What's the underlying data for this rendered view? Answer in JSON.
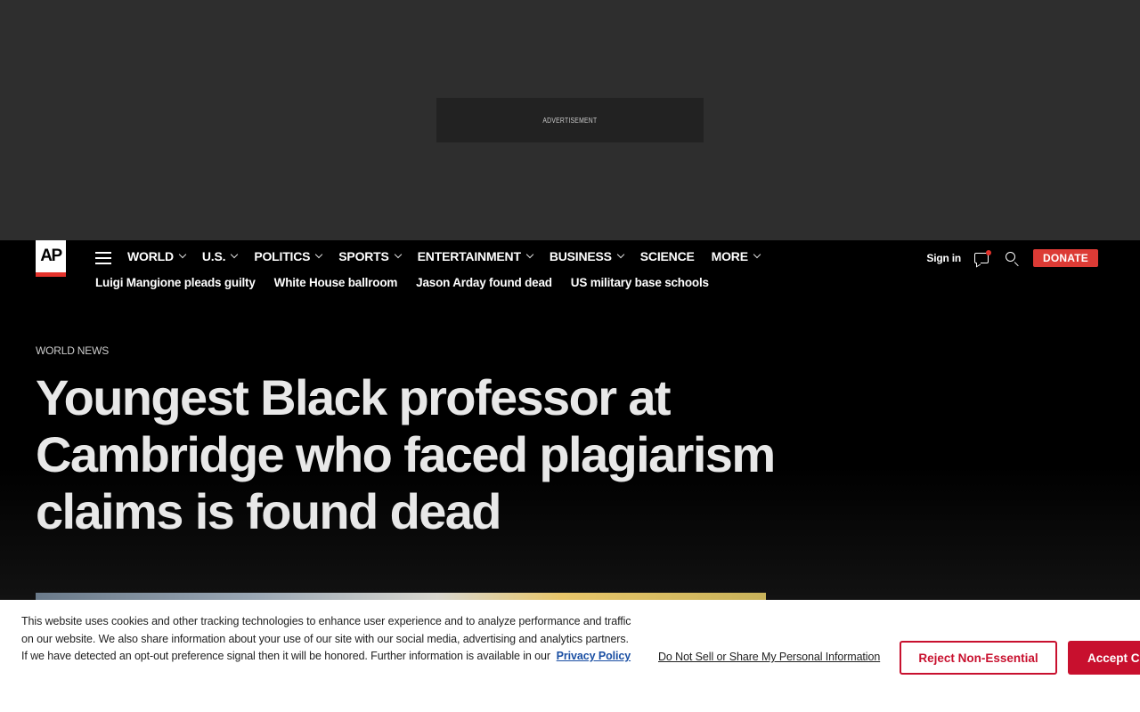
{
  "ad": {
    "label": "ADVERTISEMENT"
  },
  "header": {
    "logo": "AP",
    "nav": [
      {
        "label": "WORLD",
        "has_menu": true
      },
      {
        "label": "U.S.",
        "has_menu": true
      },
      {
        "label": "POLITICS",
        "has_menu": true
      },
      {
        "label": "SPORTS",
        "has_menu": true
      },
      {
        "label": "ENTERTAINMENT",
        "has_menu": true
      },
      {
        "label": "BUSINESS",
        "has_menu": true
      },
      {
        "label": "SCIENCE",
        "has_menu": false
      },
      {
        "label": "MORE",
        "has_menu": true
      }
    ],
    "trending": [
      "Luigi Mangione pleads guilty",
      "White House ballroom",
      "Jason Arday found dead",
      "US military base schools"
    ],
    "sign_in": "Sign in",
    "donate": "DONATE",
    "icons": [
      "menu-icon",
      "chat-icon",
      "search-icon"
    ],
    "colors": {
      "donate": "#dc3b35",
      "notification_dot": "#e4322b"
    }
  },
  "article": {
    "section": "WORLD NEWS",
    "headline": "Youngest Black professor at Cambridge who faced plagiarism claims is found dead"
  },
  "cookie_banner": {
    "text": "This website uses cookies and other tracking technologies to enhance user experience and to analyze performance and traffic on our website. We also share information about your use of our site with our social media, advertising and analytics partners. If we have detected an opt-out preference signal then it will be honored. Further information is available in our",
    "privacy_link": "Privacy Policy",
    "do_not_sell": "Do Not Sell or Share My Personal Information",
    "reject": "Reject Non-Essential",
    "accept": "Accept Cookies",
    "colors": {
      "accent": "#c8102e",
      "link": "#1a4fa3"
    }
  }
}
